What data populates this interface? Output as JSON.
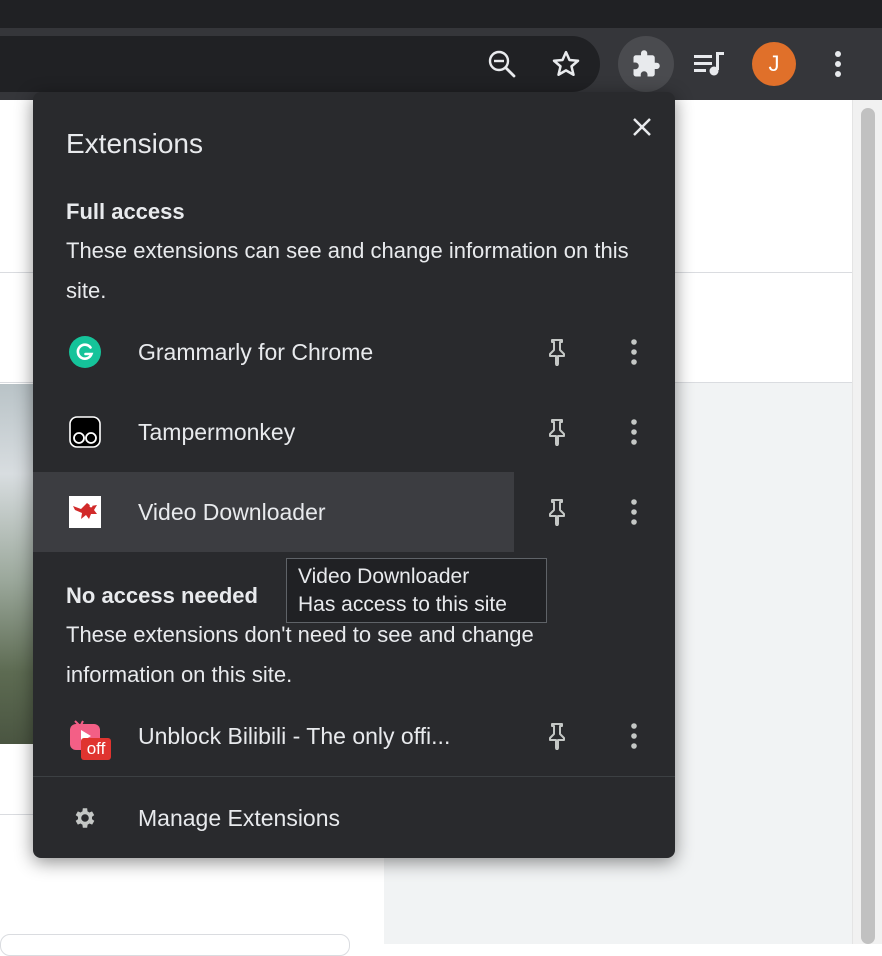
{
  "toolbar": {
    "zoom_icon": "zoom-out-icon",
    "bookmark_icon": "star-icon",
    "extensions_icon": "puzzle-icon",
    "media_icon": "media-queue-icon",
    "avatar_letter": "J",
    "avatar_color": "#e0702a",
    "menu_icon": "more-vert-icon"
  },
  "popup": {
    "title": "Extensions",
    "close_icon": "close-icon",
    "full_access": {
      "heading": "Full access",
      "description": "These extensions can see and change information on this site.",
      "items": [
        {
          "name": "Grammarly for Chrome",
          "icon": "grammarly-icon"
        },
        {
          "name": "Tampermonkey",
          "icon": "tampermonkey-icon"
        },
        {
          "name": "Video Downloader",
          "icon": "video-downloader-icon"
        }
      ]
    },
    "no_access": {
      "heading": "No access needed",
      "description": "These extensions don't need to see and change information on this site.",
      "items": [
        {
          "name": "Unblock Bilibili - The only offi...",
          "icon": "bilibili-icon",
          "badge": "off"
        }
      ]
    },
    "manage": {
      "label": "Manage Extensions",
      "icon": "gear-icon"
    }
  },
  "tooltip": {
    "line1": "Video Downloader",
    "line2": "Has access to this site"
  }
}
